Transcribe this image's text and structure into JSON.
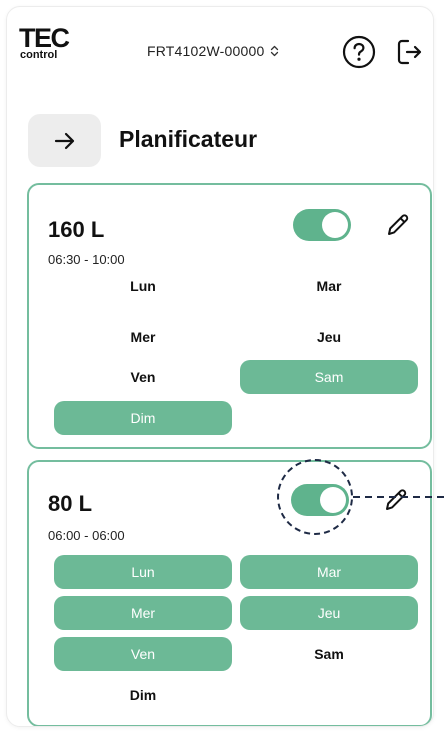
{
  "header": {
    "logo": {
      "main": "TEC",
      "sub": "control"
    },
    "device": "FRT4102W-00000",
    "icons": {
      "device_chevron": "up-down-chevron-icon",
      "help": "question-circle-icon",
      "logout": "logout-icon"
    }
  },
  "page": {
    "back_icon": "arrow-right-icon",
    "title": "Planificateur"
  },
  "schedules": [
    {
      "volume": "160 L",
      "time_range": "06:30 - 10:00",
      "enabled": true,
      "edit_icon": "pencil-icon",
      "days": [
        {
          "label": "Lun",
          "active": false
        },
        {
          "label": "Mar",
          "active": false
        },
        {
          "label": "Mer",
          "active": false
        },
        {
          "label": "Jeu",
          "active": false
        },
        {
          "label": "Ven",
          "active": false
        },
        {
          "label": "Sam",
          "active": true
        },
        {
          "label": "Dim",
          "active": true
        }
      ]
    },
    {
      "volume": "80 L",
      "time_range": "06:00 - 06:00",
      "enabled": true,
      "edit_icon": "pencil-icon",
      "days": [
        {
          "label": "Lun",
          "active": true
        },
        {
          "label": "Mar",
          "active": true
        },
        {
          "label": "Mer",
          "active": true
        },
        {
          "label": "Jeu",
          "active": true
        },
        {
          "label": "Ven",
          "active": true
        },
        {
          "label": "Sam",
          "active": false
        },
        {
          "label": "Dim",
          "active": false
        }
      ]
    }
  ],
  "colors": {
    "accent": "#6cb996",
    "toggle": "#5fb38d",
    "card_border": "#74bd9e",
    "back_button_bg": "#ededed",
    "annotation": "#1e2a45"
  }
}
